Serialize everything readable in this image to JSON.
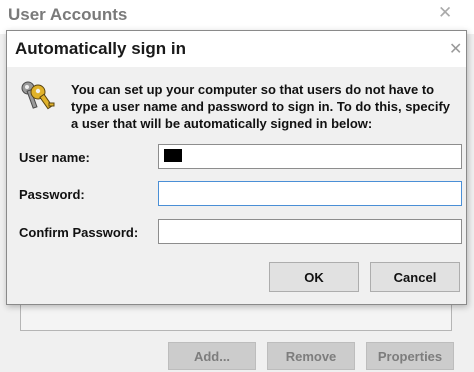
{
  "background_window": {
    "title": "User Accounts",
    "close_glyph": "✕",
    "buttons": {
      "add": "Add...",
      "remove": "Remove",
      "properties": "Properties"
    }
  },
  "dialog": {
    "title": "Automatically sign in",
    "close_glyph": "✕",
    "icon": "keys-icon",
    "description": "You can set up your computer so that users do not have to type a user name and password to sign in. To do this, specify a user that will be automatically signed in below:",
    "fields": {
      "user_name_label": "User name:",
      "password_label": "Password:",
      "confirm_password_label": "Confirm Password:"
    },
    "buttons": {
      "ok": "OK",
      "cancel": "Cancel"
    }
  },
  "colors": {
    "dialog_bg": "#f0f0f0",
    "focus_border": "#4a8fd6",
    "key_gold": "#e0b22a"
  }
}
